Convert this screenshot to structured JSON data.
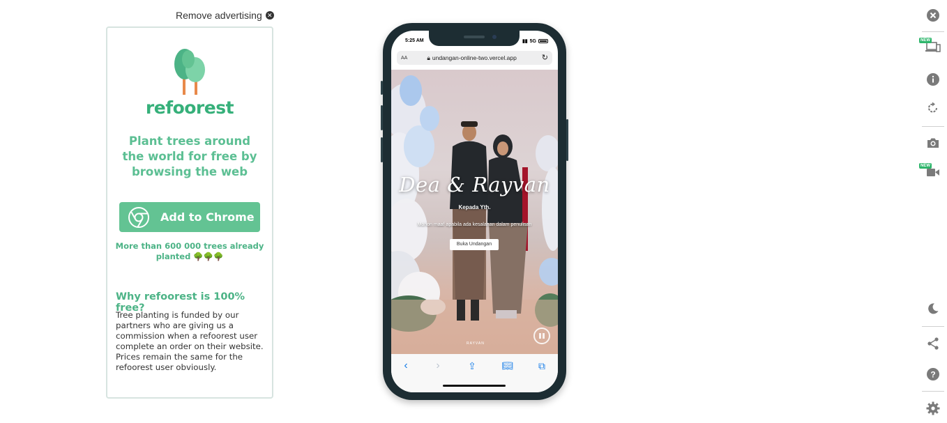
{
  "ad": {
    "remove_label": "Remove advertising",
    "brand": "refoorest",
    "tagline": "Plant trees around the world for free by browsing the web",
    "cta_label": "Add to Chrome",
    "trees_count": "More than 600 000 trees already planted 🌳🌳🌳",
    "why_title": "Why refoorest is 100% free?",
    "why_text": "Tree planting is funded by our partners who are giving us a commission when a refoorest user complete an order on their website. Prices remain the same for the refoorest user obviously.",
    "colors": {
      "brand_green": "#36b07a",
      "button_green": "#63c393"
    }
  },
  "phone": {
    "status_time": "5:25 AM",
    "status_network": "5G",
    "url_aa": "AA",
    "url": "undangan-online-two.vercel.app",
    "invitation": {
      "title": "Dea & Rayvan",
      "kepada": "Kepada Yth.",
      "message": "Mohon maaf apabila ada kesalahan dalam penulisan",
      "open_button": "Buka Undangan",
      "watermark": "RAYVAN"
    },
    "safari_icons": [
      "back-icon",
      "forward-icon",
      "share-icon",
      "bookmarks-icon",
      "tabs-icon"
    ]
  },
  "toolbar": {
    "items": [
      "close-icon",
      "device-icon",
      "info-icon",
      "rotate-icon",
      "camera-icon",
      "video-icon",
      "dark-mode-icon",
      "share-icon",
      "help-icon",
      "settings-icon"
    ],
    "new_badge": "NEW"
  }
}
